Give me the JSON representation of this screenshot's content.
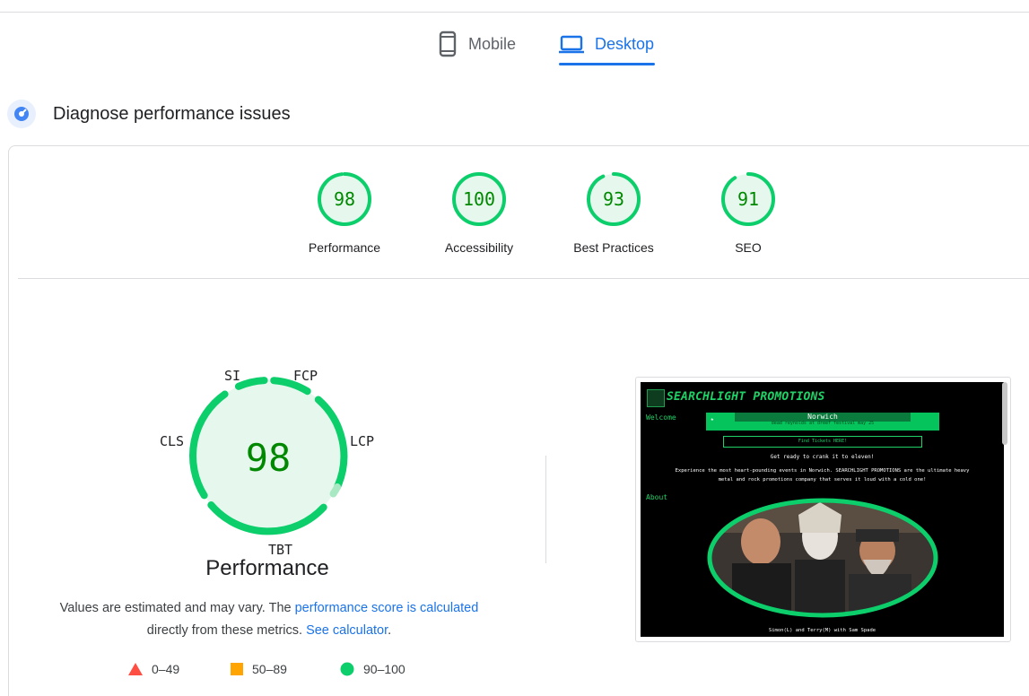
{
  "device_tabs": {
    "mobile_label": "Mobile",
    "desktop_label": "Desktop",
    "active": "Desktop"
  },
  "diagnose": {
    "title": "Diagnose performance issues"
  },
  "categories": [
    {
      "label": "Performance",
      "score": "98",
      "fraction": 0.98
    },
    {
      "label": "Accessibility",
      "score": "100",
      "fraction": 1.0
    },
    {
      "label": "Best Practices",
      "score": "93",
      "fraction": 0.93
    },
    {
      "label": "SEO",
      "score": "91",
      "fraction": 0.91
    }
  ],
  "performance": {
    "score": "98",
    "title": "Performance",
    "metrics": {
      "si": "SI",
      "fcp": "FCP",
      "lcp": "LCP",
      "tbt": "TBT",
      "cls": "CLS"
    },
    "note_prefix": "Values are estimated and may vary. The ",
    "note_link1": "performance score is calculated",
    "note_middle": " directly from these metrics. ",
    "note_link2": "See calculator",
    "note_suffix": "."
  },
  "legend": {
    "fail": "0–49",
    "average": "50–89",
    "pass": "90–100"
  },
  "colors": {
    "accent": "#1a73e8",
    "pass": "#0cce6b",
    "average": "#ffa400",
    "fail": "#ff4e42",
    "pass_text": "#008800"
  },
  "screenshot": {
    "brand": "SEARCHLIGHT PROMOTIONS",
    "welcome": "Welcome",
    "banner_city": "Norwich",
    "banner_sub": "dead reynolds at dreef festival may 25",
    "ticket_button": "Find Tickets HERE!",
    "crank": "Get ready to crank it to eleven!",
    "description": "Experience the most heart-pounding events in Norwich. SEARCHLIGHT PROMOTIONS are the ultimate heavy metal and rock promotions company that serves it loud with a cold one!",
    "about": "About",
    "caption": "Simon(L) and Terry(M) with Sam Spade"
  }
}
